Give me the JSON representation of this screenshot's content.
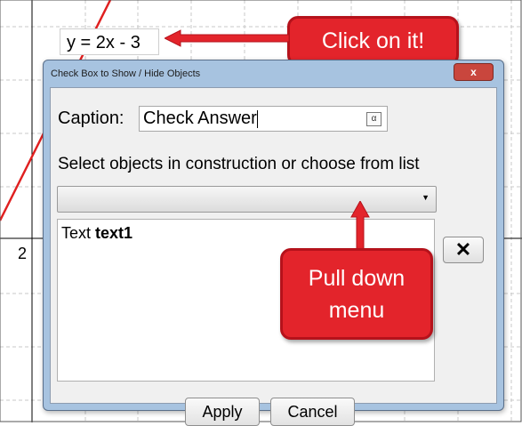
{
  "graph": {
    "equation": "y = 2x - 3",
    "axis_label": "2"
  },
  "callouts": {
    "top": "Click on it!",
    "bottom_line1": "Pull down",
    "bottom_line2": "menu",
    "color": "#e3242b"
  },
  "dialog": {
    "title": "Check Box to Show / Hide Objects",
    "close_icon": "x",
    "caption_label": "Caption:",
    "caption_value": "Check Answer",
    "alpha_symbol": "α",
    "select_label": "Select objects in construction or choose from list",
    "dropdown_value": "",
    "objects": [
      {
        "type": "Text",
        "name": "text1"
      }
    ],
    "remove_label": "✕",
    "apply_label": "Apply",
    "cancel_label": "Cancel"
  },
  "colors": {
    "dialog_frame": "#a7c3e0",
    "line": "#e02020"
  }
}
